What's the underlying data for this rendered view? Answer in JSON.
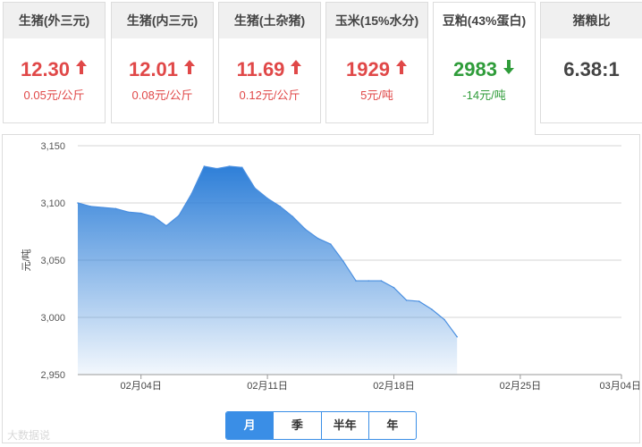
{
  "cards": [
    {
      "title": "生猪(外三元)",
      "value": "12.30",
      "change": "0.05元/公斤",
      "trend": "up"
    },
    {
      "title": "生猪(内三元)",
      "value": "12.01",
      "change": "0.08元/公斤",
      "trend": "up"
    },
    {
      "title": "生猪(土杂猪)",
      "value": "11.69",
      "change": "0.12元/公斤",
      "trend": "up"
    },
    {
      "title": "玉米(15%水分)",
      "value": "1929",
      "change": "5元/吨",
      "trend": "up"
    },
    {
      "title": "豆粕(43%蛋白)",
      "value": "2983",
      "change": "-14元/吨",
      "trend": "down"
    },
    {
      "title": "猪粮比",
      "value": "6.38:1",
      "change": "",
      "trend": "none"
    }
  ],
  "selected_card": 4,
  "chart_data": {
    "type": "area",
    "title": "",
    "xlabel": "",
    "ylabel": "元/吨",
    "ylim": [
      2950,
      3150
    ],
    "yticks": [
      "2,950",
      "3,000",
      "3,050",
      "3,100",
      "3,150"
    ],
    "xticks": [
      {
        "label": "02月04日",
        "x": 5
      },
      {
        "label": "02月11日",
        "x": 15
      },
      {
        "label": "02月18日",
        "x": 25
      },
      {
        "label": "02月25日",
        "x": 35
      },
      {
        "label": "03月04日",
        "x": 43
      }
    ],
    "x": [
      0,
      1,
      2,
      3,
      4,
      5,
      6,
      7,
      8,
      9,
      10,
      11,
      12,
      13,
      14,
      15,
      16,
      17,
      18,
      19,
      20,
      21,
      22,
      23,
      24,
      25,
      26,
      27,
      28,
      29,
      30,
      31,
      32,
      33,
      34,
      35,
      36,
      37,
      38,
      39,
      40,
      41,
      42,
      43
    ],
    "values": [
      3100,
      3097,
      3096,
      3095,
      3092,
      3091,
      3088,
      3080,
      3089,
      3108,
      3132,
      3130,
      3132,
      3131,
      3113,
      3104,
      3097,
      3088,
      3077,
      3069,
      3064,
      3049,
      3032,
      3032,
      3032,
      3026,
      3015,
      3014,
      3007,
      2998,
      2983
    ],
    "grid": true,
    "legend": "none"
  },
  "period_tabs": [
    "月",
    "季",
    "半年",
    "年"
  ],
  "selected_period": 0,
  "watermark": "大数据说"
}
